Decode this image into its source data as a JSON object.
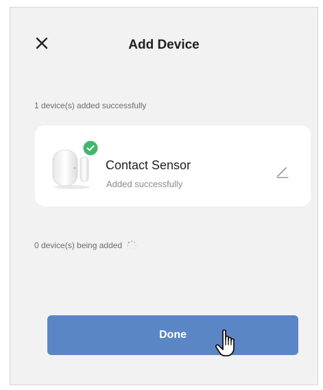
{
  "header": {
    "title": "Add Device",
    "close_icon": "close-icon"
  },
  "added_section": {
    "label": "1 device(s) added successfully"
  },
  "device": {
    "name": "Contact Sensor",
    "status": "Added successfully",
    "image_icon": "contact-sensor-icon",
    "badge_icon": "check-circle-icon",
    "edit_icon": "edit-pencil-icon"
  },
  "adding_section": {
    "label": "0 device(s) being added",
    "icon": "loading-spinner-icon"
  },
  "footer": {
    "done_label": "Done"
  },
  "colors": {
    "background": "#f2f2f2",
    "card": "#ffffff",
    "accent": "#5b86c6",
    "success": "#3fb86b",
    "text_primary": "#1f1f1f",
    "text_secondary": "#8a8a8a"
  },
  "pointer_icon": "hand-pointer-icon"
}
